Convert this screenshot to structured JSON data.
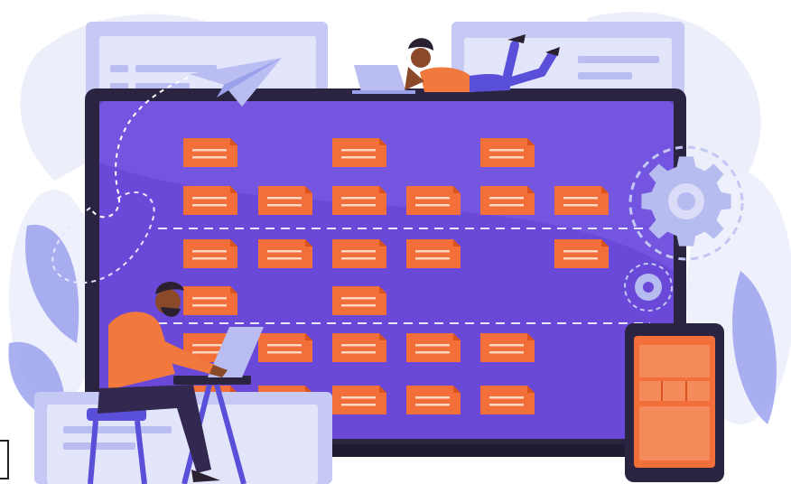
{
  "colors": {
    "background": "#ffffff",
    "blob_light": "#e8eaf8",
    "screen_frame": "#2a2440",
    "screen_purple": "#6a49d8",
    "screen_purple_light": "#7c5ee6",
    "card_orange": "#f26f3a",
    "card_orange_dark": "#d9531f",
    "card_line": "#ffd7c2",
    "panel_lavender": "#b9bdf2",
    "panel_lavender_dark": "#9aa0ea",
    "person_skin": "#8a4a2a",
    "person_hair": "#2a2030",
    "person_shirt": "#f2793e",
    "person_pants": "#33284f",
    "gear": "#b7bcf0",
    "dashed_line": "#e9e6ff"
  },
  "board": {
    "rows": [
      {
        "cards": [
          1,
          3,
          5
        ]
      },
      {
        "cards": [
          1,
          2,
          3,
          4,
          5,
          6
        ]
      },
      {
        "cards": [
          1,
          2,
          3,
          4,
          6
        ]
      },
      {
        "cards": [
          1,
          3
        ]
      },
      {
        "cards": [
          1,
          2,
          3,
          4,
          5
        ]
      },
      {
        "cards": [
          1,
          2,
          3,
          4,
          5
        ]
      }
    ]
  },
  "icons": [
    "paper-plane-icon",
    "gear-icon",
    "small-gear-icon",
    "laptop-icon",
    "tablet-icon"
  ]
}
